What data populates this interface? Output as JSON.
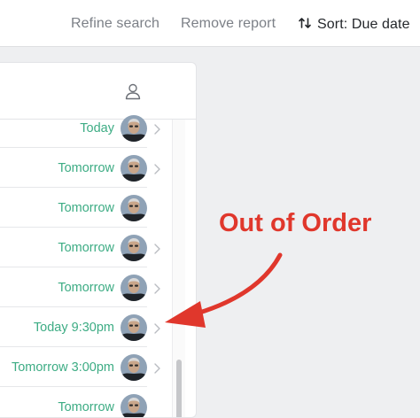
{
  "toolbar": {
    "refine_label": "Refine search",
    "remove_label": "Remove report",
    "sort_label": "Sort: Due date",
    "sort_icon": "sort-arrows-icon"
  },
  "panel": {
    "header_icon": "user-icon",
    "rows": [
      {
        "date": "Today",
        "chevron": true
      },
      {
        "date": "Tomorrow",
        "chevron": true
      },
      {
        "date": "Tomorrow",
        "chevron": false
      },
      {
        "date": "Tomorrow",
        "chevron": true
      },
      {
        "date": "Tomorrow",
        "chevron": true
      },
      {
        "date": "Today 9:30pm",
        "chevron": true
      },
      {
        "date": "Tomorrow 3:00pm",
        "chevron": true
      },
      {
        "date": "Tomorrow",
        "chevron": false
      }
    ]
  },
  "annotation": {
    "text": "Out of Order",
    "color": "#e0372c"
  },
  "colors": {
    "date_text": "#3dac84",
    "toolbar_text": "#7c8087",
    "background": "#eeeff1"
  }
}
